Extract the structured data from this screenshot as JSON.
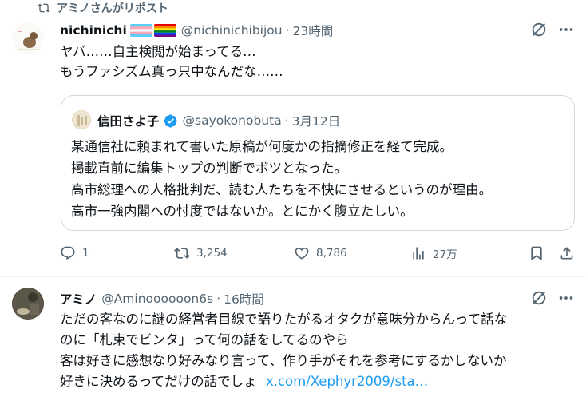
{
  "repost": {
    "label": "アミノさんがリポスト"
  },
  "tweet1": {
    "name": "nichinichi",
    "handle": "@nichinichibijou",
    "time": "23時間",
    "lines": [
      "ヤバ……自主検閲が始まってる…",
      "もうファシズム真っ只中なんだな……"
    ],
    "quote": {
      "name": "信田さよ子",
      "handle": "@sayokonobuta",
      "date": "3月12日",
      "lines": [
        "某通信社に頼まれて書いた原稿が何度かの指摘修正を経て完成。",
        "掲載直前に編集トップの判断でボツとなった。",
        "高市総理への人格批判だ、読む人たちを不快にさせるというのが理由。",
        "高市一強内閣への忖度ではないか。とにかく腹立たしい。"
      ]
    },
    "actions": {
      "replies": "1",
      "reposts": "3,254",
      "likes": "8,786",
      "views": "27万"
    }
  },
  "tweet2": {
    "name": "アミノ",
    "handle": "@Aminoooooon6s",
    "time": "16時間",
    "lines": [
      "ただの客なのに謎の経営者目線で語りたがるオタクが意味分からんって話な",
      "のに「札束でビンタ」って何の話をしてるのやら",
      "客は好きに感想なり好みなり言って、作り手がそれを参考にするかしないか"
    ],
    "last_line": "好きに決めるってだけの話でしょ",
    "link": "x.com/Xephyr2009/sta…"
  },
  "colors": {
    "accent": "#1d9bf0",
    "muted": "#536471",
    "text": "#0f1419",
    "verified": "#1d9bf0"
  },
  "icons": [
    "repost-icon",
    "grok-icon",
    "more-icon",
    "reply-icon",
    "like-icon",
    "views-icon",
    "bookmark-icon",
    "share-icon",
    "verified-badge-icon"
  ]
}
